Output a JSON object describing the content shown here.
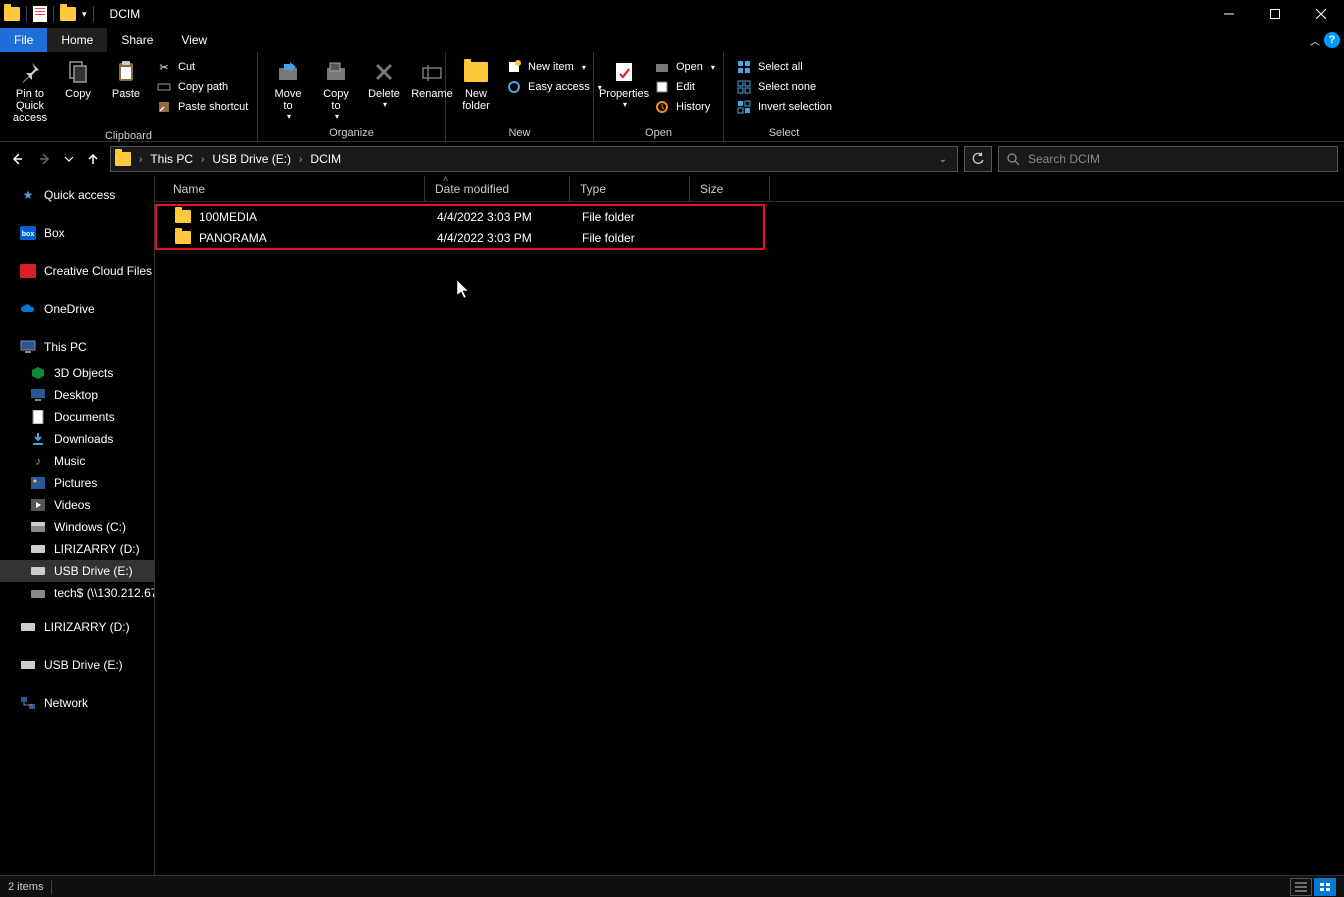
{
  "window": {
    "title": "DCIM"
  },
  "tabs": {
    "file": "File",
    "home": "Home",
    "share": "Share",
    "view": "View"
  },
  "ribbon": {
    "clipboard": {
      "label": "Clipboard",
      "pin": "Pin to Quick\naccess",
      "copy": "Copy",
      "paste": "Paste",
      "cut": "Cut",
      "copy_path": "Copy path",
      "paste_shortcut": "Paste shortcut"
    },
    "organize": {
      "label": "Organize",
      "move_to": "Move\nto",
      "copy_to": "Copy\nto",
      "delete": "Delete",
      "rename": "Rename"
    },
    "new": {
      "label": "New",
      "new_folder": "New\nfolder",
      "new_item": "New item",
      "easy_access": "Easy access"
    },
    "open": {
      "label": "Open",
      "properties": "Properties",
      "open": "Open",
      "edit": "Edit",
      "history": "History"
    },
    "select": {
      "label": "Select",
      "select_all": "Select all",
      "select_none": "Select none",
      "invert": "Invert selection"
    }
  },
  "breadcrumb": [
    "This PC",
    "USB Drive (E:)",
    "DCIM"
  ],
  "search": {
    "placeholder": "Search DCIM"
  },
  "sidebar": {
    "quick_access": "Quick access",
    "box": "Box",
    "creative_cloud": "Creative Cloud Files",
    "onedrive": "OneDrive",
    "this_pc": "This PC",
    "subs": [
      "3D Objects",
      "Desktop",
      "Documents",
      "Downloads",
      "Music",
      "Pictures",
      "Videos",
      "Windows (C:)",
      "LIRIZARRY (D:)",
      "USB Drive (E:)",
      "tech$ (\\\\130.212.67."
    ],
    "lirizarry": "LIRIZARRY (D:)",
    "usb": "USB Drive (E:)",
    "network": "Network"
  },
  "columns": {
    "name": "Name",
    "date": "Date modified",
    "type": "Type",
    "size": "Size"
  },
  "rows": [
    {
      "name": "100MEDIA",
      "date": "4/4/2022 3:03 PM",
      "type": "File folder"
    },
    {
      "name": "PANORAMA",
      "date": "4/4/2022 3:03 PM",
      "type": "File folder"
    }
  ],
  "status": {
    "items": "2 items"
  }
}
